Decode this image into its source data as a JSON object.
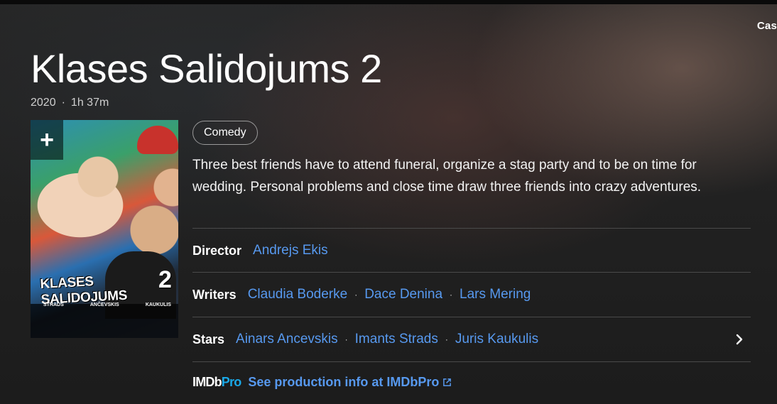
{
  "header": {
    "cast_tab": "Cas"
  },
  "movie": {
    "title": "Klases Salidojums 2",
    "year": "2020",
    "meta_separator": "·",
    "runtime": "1h 37m",
    "genre": "Comedy",
    "plot": "Three best friends have to attend funeral, organize a stag party and to be on time for wedding. Personal problems and close time draw three friends into crazy adventures."
  },
  "poster": {
    "add_icon": "+",
    "title_text": "KLASES SALIDOJUMS",
    "title_number": "2",
    "names": [
      "STRADS",
      "ANČEVSKIS",
      "KAUKULIS"
    ]
  },
  "credits": {
    "director": {
      "label": "Director",
      "names": [
        "Andrejs Ekis"
      ]
    },
    "writers": {
      "label": "Writers",
      "names": [
        "Claudia Boderke",
        "Dace Denina",
        "Lars Mering"
      ]
    },
    "stars": {
      "label": "Stars",
      "names": [
        "Ainars Ancevskis",
        "Imants Strads",
        "Juris Kaukulis"
      ]
    },
    "separator": "·"
  },
  "imdbpro": {
    "logo_imdb": "IMDb",
    "logo_pro": "Pro",
    "link_text": "See production info at IMDbPro"
  },
  "icons": {
    "chevron": "chevron-right-icon",
    "external": "external-link-icon"
  },
  "colors": {
    "link": "#5799ef",
    "pro_accent": "#1aa8e6",
    "background": "#1f1f1f"
  }
}
